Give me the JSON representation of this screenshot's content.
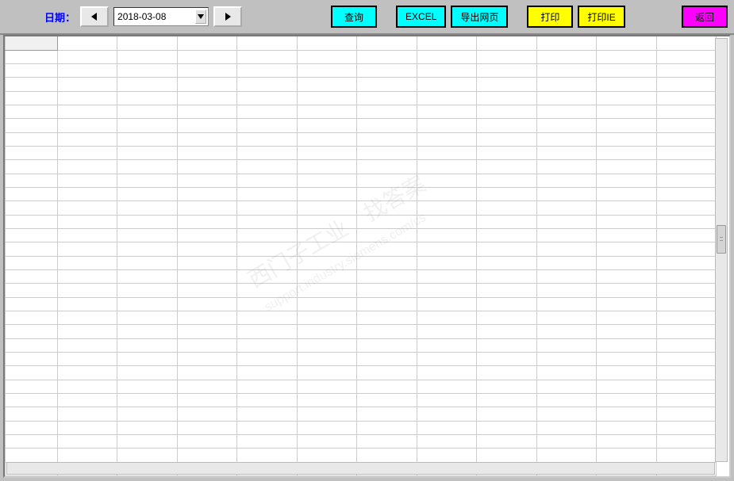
{
  "toolbar": {
    "date_label": "日期：",
    "date_value": "2018-03-08",
    "query_label": "查询",
    "excel_label": "EXCEL",
    "export_web_label": "导出网页",
    "print_label": "打印",
    "print_ie_label": "打印IE",
    "back_label": "返回"
  },
  "watermark": {
    "line1": "西门子工业　找答案",
    "line2": "support.industry.siemens.com/cs"
  },
  "grid": {
    "columns": 12,
    "rows": 32
  }
}
